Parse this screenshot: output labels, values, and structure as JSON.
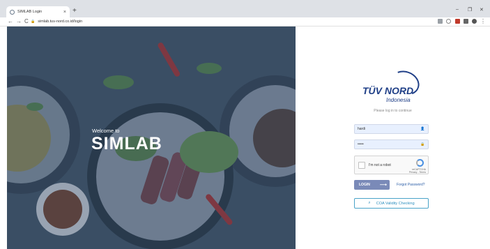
{
  "browser": {
    "tab_title": "SIMLAB Login",
    "tab_close": "×",
    "new_tab": "+",
    "url": "simlab.tuv-nord.co.id/login",
    "back": "←",
    "forward": "→",
    "reload": "C",
    "minimize": "–",
    "maximize": "❐",
    "close": "✕"
  },
  "hero": {
    "welcome": "Welcome to",
    "brand": "SIMLAB"
  },
  "login": {
    "logo_main": "TÜV NORD",
    "logo_sub": "Indonesia",
    "subtitle": "Please log in to continue",
    "username_value": "hardi",
    "password_value": "•••••",
    "captcha_label": "I'm not a robot",
    "captcha_brand": "reCAPTCHA",
    "captcha_links": "Privacy - Terms",
    "login_label": "LOGIN",
    "login_arrow": "⟶",
    "forgot_label": "Forgot Password?",
    "coa_label": "COA Validity Checking"
  },
  "colors": {
    "brand_blue": "#1f3f87",
    "login_button": "#7a8ab8",
    "hero_overlay": "#3d4f63"
  }
}
